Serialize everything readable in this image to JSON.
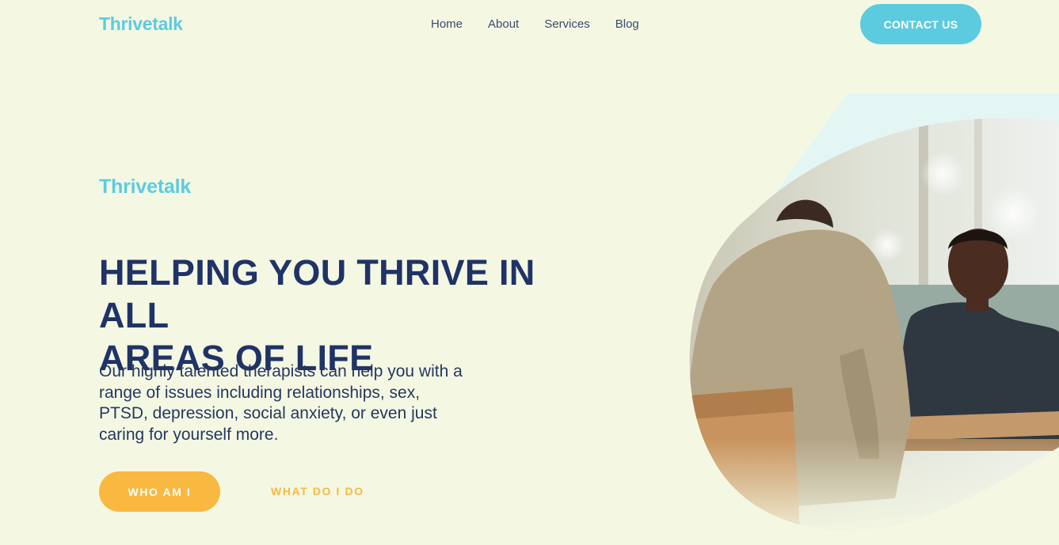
{
  "header": {
    "logo": "Thrivetalk",
    "nav": [
      "Home",
      "About",
      "Services",
      "Blog"
    ],
    "contact_label": "CONTACT US"
  },
  "hero": {
    "eyebrow": "Thrivetalk",
    "headline_line1": "HELPING YOU THRIVE IN ALL",
    "headline_line2": "AREAS OF LIFE",
    "body": "Our highly talented therapists can help you with a range of issues including relationships, sex, PTSD, depression, social anxiety, or even just caring for yourself more.",
    "primary_button": "WHO AM I",
    "secondary_link": "WHAT DO I DO",
    "image": "photo of two people talking at a table"
  },
  "colors": {
    "background": "#f4f8e3",
    "brand_teal": "#5ccbe0",
    "navy": "#1f3366",
    "accent_yellow": "#f9b840"
  }
}
